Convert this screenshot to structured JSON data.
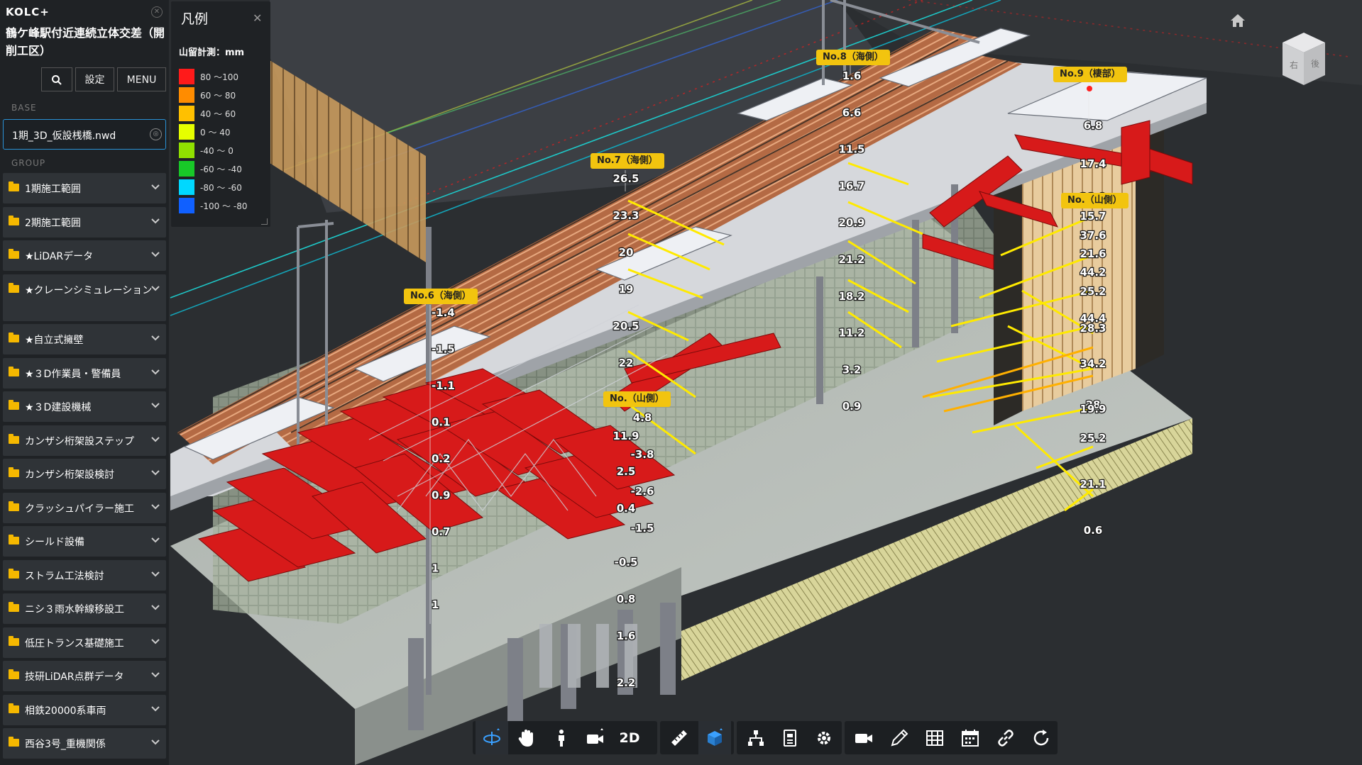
{
  "app": {
    "brand": "KOLC+",
    "project_title": "鶴ケ峰駅付近連続立体交差（開削工区）"
  },
  "toolbar": {
    "search_icon": "search-icon",
    "settings_label": "設定",
    "menu_label": "MENU"
  },
  "base": {
    "section_label": "BASE",
    "file_name": "1期_3D_仮設桟橋.nwd"
  },
  "group": {
    "section_label": "GROUP",
    "items": [
      {
        "label": "1期施工範囲"
      },
      {
        "label": "2期施工範囲"
      },
      {
        "label": "★LiDARデータ"
      },
      {
        "label": "★クレーンシミュレーション"
      },
      {
        "label": "★自立式擁壁"
      },
      {
        "label": "★３D作業員・警備員"
      },
      {
        "label": "★３D建設機械"
      },
      {
        "label": "カンザシ桁架設ステップ"
      },
      {
        "label": "カンザシ桁架設検討"
      },
      {
        "label": "クラッシュパイラー施工"
      },
      {
        "label": "シールド設備"
      },
      {
        "label": "ストラム工法検討"
      },
      {
        "label": "ニシ３雨水幹線移設工"
      },
      {
        "label": "低圧トランス基礎施工"
      },
      {
        "label": "技研LiDAR点群データ"
      },
      {
        "label": "相鉄20000系車両"
      },
      {
        "label": "西谷3号_重機関係"
      }
    ]
  },
  "legend": {
    "title": "凡例",
    "subtitle": "山留計測：mm",
    "rows": [
      {
        "color": "#ff1a1a",
        "label": "80 ～100"
      },
      {
        "color": "#ff8c00",
        "label": "60 ～ 80"
      },
      {
        "color": "#ffc000",
        "label": "40 ～ 60"
      },
      {
        "color": "#e6ff00",
        "label": "0 ～ 40"
      },
      {
        "color": "#90e000",
        "label": "-40 ～ 0"
      },
      {
        "color": "#18c828",
        "label": "-60 ～ -40"
      },
      {
        "color": "#00d8ff",
        "label": "-80 ～ -60"
      },
      {
        "color": "#1060ff",
        "label": "-100 ～ -80"
      }
    ]
  },
  "measurement_points": [
    {
      "tag": "No.6（海側）",
      "values": [
        "-1.4",
        "-1.5",
        "-1.1",
        "0.1",
        "0.2",
        "0.9",
        "0.7",
        "1",
        "1"
      ]
    },
    {
      "tag": "No.7（海側）",
      "values": [
        "26.5",
        "23.3",
        "20",
        "19",
        "20.5",
        "22",
        "20",
        "11.9",
        "2.5",
        "0.4",
        "-0.5",
        "0.8",
        "1.6",
        "2.2"
      ]
    },
    {
      "tag": "No.8（海側）",
      "values": [
        "1.6",
        "6.6",
        "11.5",
        "16.7",
        "20.9",
        "21.2",
        "18.2",
        "11.2",
        "3.2",
        "0.9"
      ]
    },
    {
      "tag": "No.9（棲部）",
      "values": [
        "6.8",
        "17.4",
        "28.9",
        "15.7",
        "37.6",
        "21.6",
        "44.2",
        "25.2",
        "44.4",
        "28.3",
        "34.2",
        "28",
        "19.9",
        "25.2",
        "21.1",
        "0.6"
      ]
    },
    {
      "tag": "No.（山側）",
      "values": [
        "4.8",
        "-3.8",
        "-2.6",
        "-1.5"
      ]
    },
    {
      "tag": "No.（山側）",
      "values": []
    }
  ],
  "bottom_toolbar": {
    "orbit_icon": "orbit-icon",
    "pan_icon": "pan-hand-icon",
    "walk_icon": "walk-person-icon",
    "camera_icon": "camera-icon",
    "mode_2d_label": "2D",
    "measure_icon": "ruler-icon",
    "section_icon": "section-box-icon",
    "tree_icon": "model-tree-icon",
    "properties_icon": "properties-icon",
    "settings_icon": "gear-icon",
    "record_icon": "video-icon",
    "markup_icon": "pencil-icon",
    "table_icon": "table-icon",
    "calendar_icon": "calendar-icon",
    "link_icon": "link-icon",
    "refresh_icon": "refresh-icon"
  },
  "viewcube": {
    "home_icon": "home-icon",
    "face_labels": [
      "右",
      "後"
    ]
  }
}
